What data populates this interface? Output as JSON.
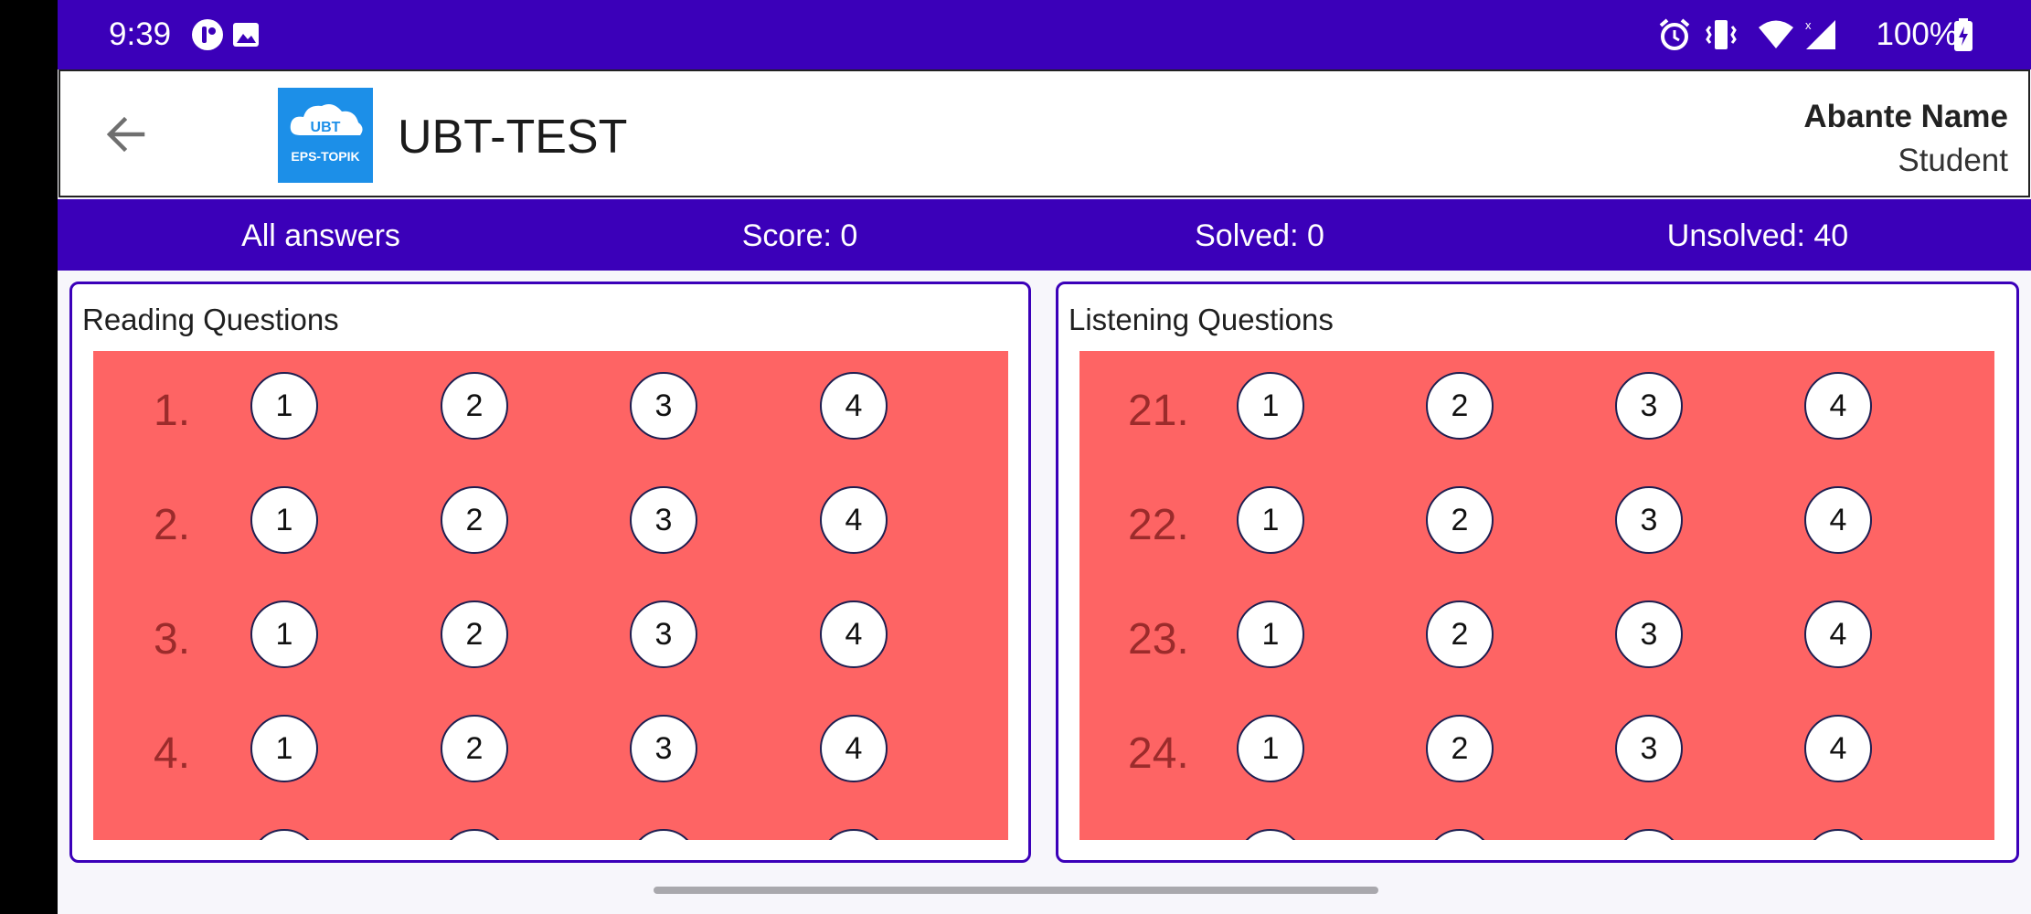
{
  "status_bar": {
    "time": "9:39",
    "battery": "100%",
    "icons": [
      "app-notification-icon",
      "image-icon",
      "alarm-icon",
      "vibrate-icon",
      "wifi-icon",
      "cellular-signal-icon",
      "battery-charging-icon"
    ]
  },
  "app_bar": {
    "back_icon": "arrow-left-icon",
    "logo_text_top": "UBT",
    "logo_text_bottom": "EPS-TOPIK",
    "title": "UBT-TEST",
    "user_name": "Abante Name",
    "user_role": "Student"
  },
  "summary": {
    "all_answers": "All answers",
    "score": "Score: 0",
    "solved": "Solved: 0",
    "unsolved": "Unsolved: 40"
  },
  "reading": {
    "title": "Reading Questions",
    "questions": [
      {
        "number": "1.",
        "options": [
          "1",
          "2",
          "3",
          "4"
        ]
      },
      {
        "number": "2.",
        "options": [
          "1",
          "2",
          "3",
          "4"
        ]
      },
      {
        "number": "3.",
        "options": [
          "1",
          "2",
          "3",
          "4"
        ]
      },
      {
        "number": "4.",
        "options": [
          "1",
          "2",
          "3",
          "4"
        ]
      }
    ]
  },
  "listening": {
    "title": "Listening Questions",
    "questions": [
      {
        "number": "21.",
        "options": [
          "1",
          "2",
          "3",
          "4"
        ]
      },
      {
        "number": "22.",
        "options": [
          "1",
          "2",
          "3",
          "4"
        ]
      },
      {
        "number": "23.",
        "options": [
          "1",
          "2",
          "3",
          "4"
        ]
      },
      {
        "number": "24.",
        "options": [
          "1",
          "2",
          "3",
          "4"
        ]
      }
    ]
  },
  "colors": {
    "primary": "#3b00b9",
    "grid_bg": "#fe6464",
    "question_number": "#9b2b2b",
    "logo_bg": "#1c8fe8"
  }
}
